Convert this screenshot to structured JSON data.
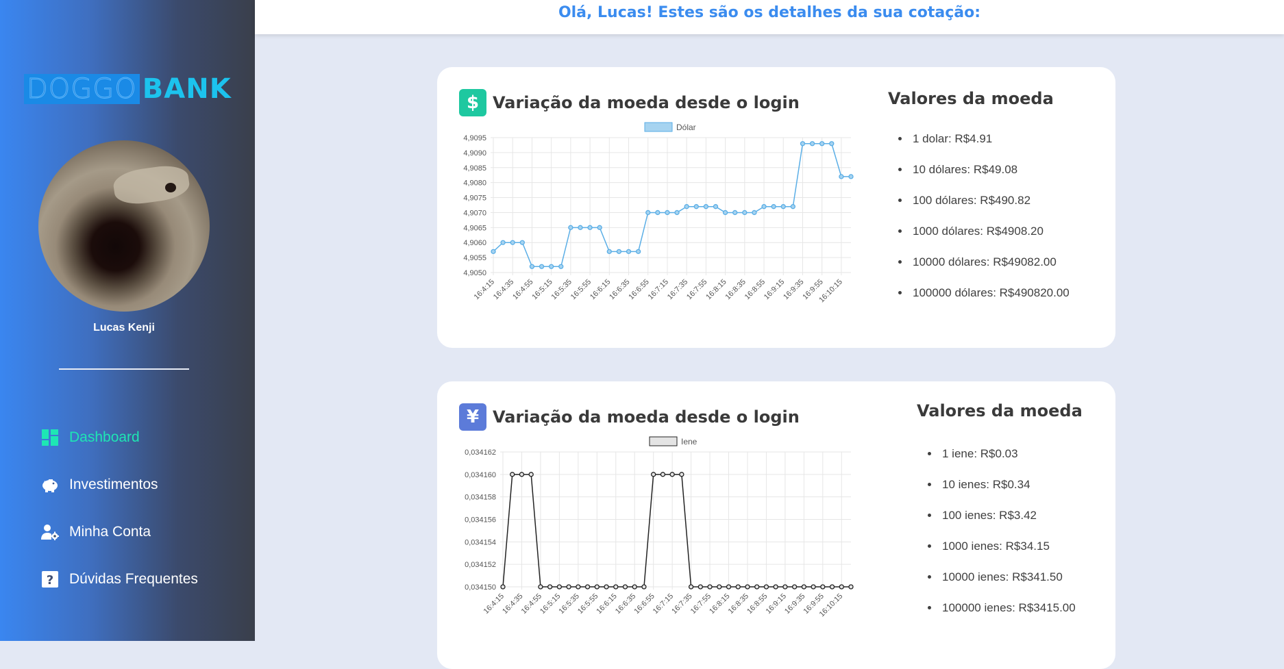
{
  "app": {
    "logo_part1": "DOGGO",
    "logo_part2": "BANK",
    "user_name": "Lucas Kenji"
  },
  "nav": [
    {
      "label": "Dashboard",
      "icon": "dashboard-icon",
      "active": true
    },
    {
      "label": "Investimentos",
      "icon": "piggy-bank-icon",
      "active": false
    },
    {
      "label": "Minha Conta",
      "icon": "user-cog-icon",
      "active": false
    },
    {
      "label": "Dúvidas Frequentes",
      "icon": "question-icon",
      "active": false
    }
  ],
  "header": {
    "greeting": "Olá, Lucas! Estes são os detalhes da sua cotação:"
  },
  "colors": {
    "accent": "#3b8cef",
    "active_nav": "#1ee6b4",
    "dollar_icon_bg": "#1ec8a0",
    "yen_icon_bg": "#5c7bd9",
    "dollar_line": "#5aaee6",
    "dollar_fill": "#a6d3f0",
    "yen_line": "#222222",
    "yen_fill": "#e4e4e4"
  },
  "cards": [
    {
      "currency_symbol": "$",
      "icon": "dollar-icon",
      "title": "Variação da moeda desde o login",
      "values_title": "Valores da moeda",
      "values": [
        "1 dolar: R$4.91",
        "10 dólares: R$49.08",
        "100 dólares: R$490.82",
        "1000 dólares: R$4908.20",
        "10000 dólares: R$49082.00",
        "100000 dólares: R$490820.00"
      ]
    },
    {
      "currency_symbol": "¥",
      "icon": "yen-icon",
      "title": "Variação da moeda desde o login",
      "values_title": "Valores da moeda",
      "values": [
        "1 iene: R$0.03",
        "10 ienes: R$0.34",
        "100 ienes: R$3.42",
        "1000 ienes: R$34.15",
        "10000 ienes: R$341.50",
        "100000 ienes: R$3415.00"
      ]
    }
  ],
  "chart_data": [
    {
      "type": "line",
      "legend": "Dólar",
      "legend_position": "top",
      "grid": true,
      "x_tick_labels": [
        "16:4:15",
        "16:4:35",
        "16:4:55",
        "16:5:15",
        "16:5:35",
        "16:5:55",
        "16:6:15",
        "16:6:35",
        "16:6:55",
        "16:7:15",
        "16:7:35",
        "16:7:55",
        "16:8:15",
        "16:8:35",
        "16:8:55",
        "16:9:15",
        "16:9:35",
        "16:9:55",
        "16:10:15"
      ],
      "y_ticks": [
        "4,9050",
        "4,9055",
        "4,9060",
        "4,9065",
        "4,9070",
        "4,9075",
        "4,9080",
        "4,9085",
        "4,9090",
        "4,9095"
      ],
      "ylim": [
        4.905,
        4.9095
      ],
      "series": [
        {
          "name": "Dólar",
          "values": [
            4.9057,
            4.906,
            4.906,
            4.906,
            4.9052,
            4.9052,
            4.9052,
            4.9052,
            4.9065,
            4.9065,
            4.9065,
            4.9065,
            4.9057,
            4.9057,
            4.9057,
            4.9057,
            4.907,
            4.907,
            4.907,
            4.907,
            4.9072,
            4.9072,
            4.9072,
            4.9072,
            4.907,
            4.907,
            4.907,
            4.907,
            4.9072,
            4.9072,
            4.9072,
            4.9072,
            4.9093,
            4.9093,
            4.9093,
            4.9093,
            4.9082,
            4.9082
          ]
        }
      ]
    },
    {
      "type": "line",
      "legend": "Iene",
      "legend_position": "top",
      "grid": true,
      "x_tick_labels": [
        "16:4:15",
        "16:4:35",
        "16:4:55",
        "16:5:15",
        "16:5:35",
        "16:5:55",
        "16:6:15",
        "16:6:35",
        "16:6:55",
        "16:7:15",
        "16:7:35",
        "16:7:55",
        "16:8:15",
        "16:8:35",
        "16:8:55",
        "16:9:15",
        "16:9:35",
        "16:9:55",
        "16:10:15"
      ],
      "y_ticks": [
        "0,034150",
        "0,034152",
        "0,034154",
        "0,034156",
        "0,034158",
        "0,034160",
        "0,034162"
      ],
      "ylim": [
        0.03415,
        0.034162
      ],
      "series": [
        {
          "name": "Iene",
          "values": [
            0.03415,
            0.03416,
            0.03416,
            0.03416,
            0.03415,
            0.03415,
            0.03415,
            0.03415,
            0.03415,
            0.03415,
            0.03415,
            0.03415,
            0.03415,
            0.03415,
            0.03415,
            0.03415,
            0.03416,
            0.03416,
            0.03416,
            0.03416,
            0.03415,
            0.03415,
            0.03415,
            0.03415,
            0.03415,
            0.03415,
            0.03415,
            0.03415,
            0.03415,
            0.03415,
            0.03415,
            0.03415,
            0.03415,
            0.03415,
            0.03415,
            0.03415,
            0.03415,
            0.03415
          ]
        }
      ]
    }
  ]
}
